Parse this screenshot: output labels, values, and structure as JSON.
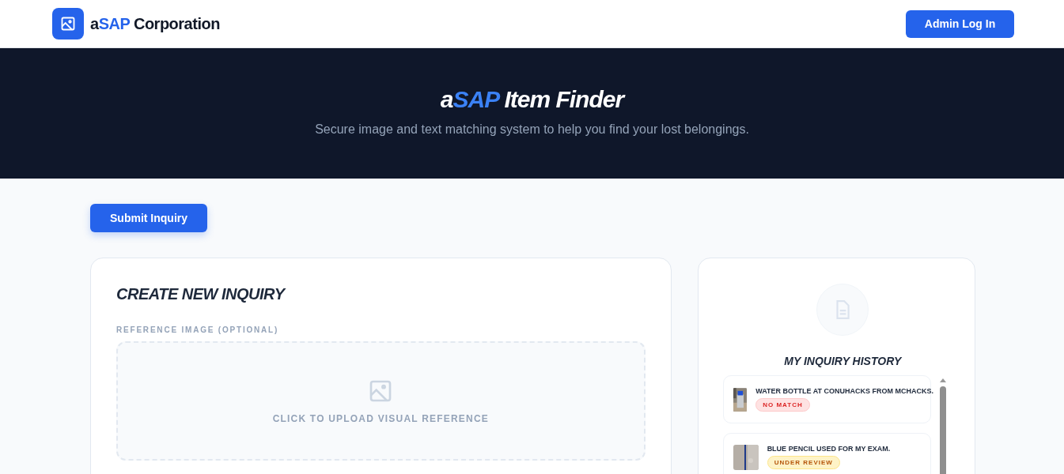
{
  "header": {
    "brand": [
      {
        "text": "a",
        "highlight": false
      },
      {
        "text": "SAP",
        "highlight": true
      },
      {
        "text": " Corporation",
        "highlight": false
      }
    ],
    "button": "Admin Log In"
  },
  "hero": {
    "title": [
      {
        "text": "a",
        "highlight": false
      },
      {
        "text": "SAP",
        "highlight": true
      },
      {
        "text": " Item Finder",
        "highlight": false
      }
    ],
    "subtitle": "Secure image and text matching system to help you find your lost belongings."
  },
  "submit_button": "Submit Inquiry",
  "form": {
    "title": "CREATE NEW INQUIRY",
    "image_label": "REFERENCE IMAGE (OPTIONAL)",
    "upload_text": "CLICK TO UPLOAD VISUAL REFERENCE"
  },
  "history": {
    "title": "MY INQUIRY HISTORY",
    "items": [
      {
        "text": "WATER BOTTLE AT CONUHACKS FROM MCHACKS.",
        "status": "NO MATCH",
        "kind": "no_match"
      },
      {
        "text": "BLUE PENCIL USED FOR MY EXAM.",
        "status": "UNDER REVIEW",
        "kind": "under_review"
      }
    ]
  }
}
